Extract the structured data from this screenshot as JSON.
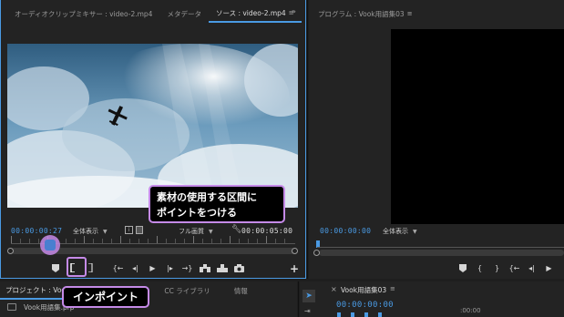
{
  "source_panel": {
    "tabs": [
      {
        "label": "オーディオクリップミキサー : video-2.mp4",
        "active": false
      },
      {
        "label": "メタデータ",
        "active": false
      },
      {
        "label": "ソース : video-2.mp4",
        "active": true
      }
    ],
    "timecode_current": "00:00:00:27",
    "zoom": "全体表示",
    "resolution": "フル画質",
    "timecode_duration": "00:00:05:00"
  },
  "program_panel": {
    "tab": "プログラム : Vook用語集03",
    "timecode": "00:00:00:00",
    "zoom": "全体表示"
  },
  "project_panel": {
    "tabs": [
      {
        "label": "プロジェクト : Vook",
        "active": true
      },
      {
        "label": "CC ライブラリ",
        "active": false
      },
      {
        "label": "情報",
        "active": false
      }
    ],
    "item": "Vook用語集.prp"
  },
  "timeline_panel": {
    "tab": "Vook用語集03",
    "timecode": "00:00:00:00",
    "ruler_label": ":00:00"
  },
  "annotations": {
    "top": [
      "素材の使用する区間に",
      "ポイントをつける"
    ],
    "bottom": "インポイント"
  },
  "colors": {
    "accent": "#4a9ae3",
    "callout_border": "#c58ae8",
    "highlight_border": "#c58ae8"
  }
}
